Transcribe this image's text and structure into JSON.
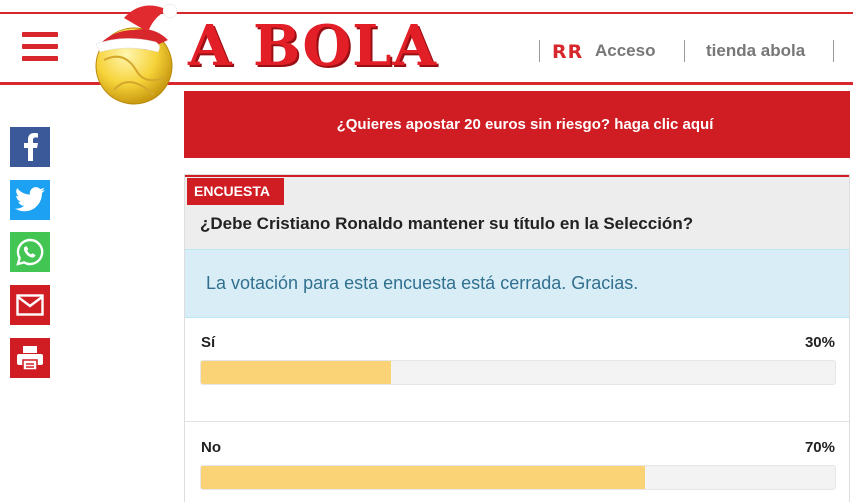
{
  "header": {
    "logo_text": "A BOLA",
    "rr_badge": "RR",
    "nav": {
      "acceso": "Acceso",
      "tienda": "tienda abola"
    }
  },
  "share": [
    {
      "icon": "facebook-icon",
      "color": "#3b5998"
    },
    {
      "icon": "twitter-icon",
      "color": "#1da1f2"
    },
    {
      "icon": "whatsapp-icon",
      "color": "#43c553"
    },
    {
      "icon": "email-icon",
      "color": "#d01d24"
    },
    {
      "icon": "print-icon",
      "color": "#d01d24"
    }
  ],
  "promo": {
    "text": "¿Quieres apostar 20 euros sin riesgo? haga clic aquí"
  },
  "poll": {
    "label": "ENCUESTA",
    "question": "¿Debe Cristiano Ronaldo mantener su título en la Selección?",
    "notice": "La votación para esta encuesta está cerrada. Gracias.",
    "options": [
      {
        "label": "Sí",
        "percent_text": "30%",
        "percent": 30
      },
      {
        "label": "No",
        "percent_text": "70%",
        "percent": 70
      }
    ]
  },
  "colors": {
    "brand_red": "#d01d24",
    "bar_fill": "#fbd377",
    "notice_bg": "#d9edf7",
    "notice_text": "#31708f"
  }
}
